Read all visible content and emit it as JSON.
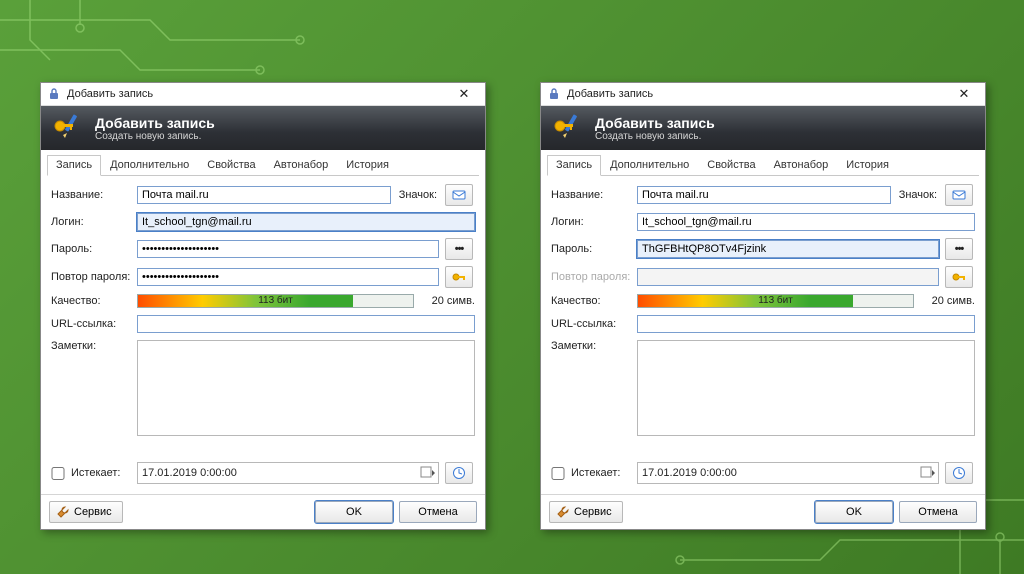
{
  "window": {
    "title": "Добавить запись",
    "banner_title": "Добавить запись",
    "banner_sub": "Создать новую запись."
  },
  "tabs": {
    "t0": "Запись",
    "t1": "Дополнительно",
    "t2": "Свойства",
    "t3": "Автонабор",
    "t4": "История"
  },
  "labels": {
    "name": "Название:",
    "icon": "Значок:",
    "login": "Логин:",
    "password": "Пароль:",
    "repeat": "Повтор пароля:",
    "quality": "Качество:",
    "url": "URL-ссылка:",
    "notes": "Заметки:",
    "expires": "Истекает:"
  },
  "left": {
    "name_value": "Почта mail.ru",
    "login_value": "It_school_tgn@mail.ru",
    "password_value": "••••••••••••••••••••",
    "repeat_value": "••••••••••••••••••••",
    "quality_text": "113 бит",
    "quality_percent": 78,
    "char_count": "20 симв.",
    "url_value": "",
    "notes_value": "",
    "expire_value": "17.01.2019  0:00:00"
  },
  "right": {
    "name_value": "Почта mail.ru",
    "login_value": "It_school_tgn@mail.ru",
    "password_value": "ThGFBHtQP8OTv4Fjzink",
    "repeat_value": "",
    "quality_text": "113 бит",
    "quality_percent": 78,
    "char_count": "20 симв.",
    "url_value": "",
    "notes_value": "",
    "expire_value": "17.01.2019  0:00:00"
  },
  "buttons": {
    "service": "Сервис",
    "ok": "OK",
    "cancel": "Отмена"
  }
}
